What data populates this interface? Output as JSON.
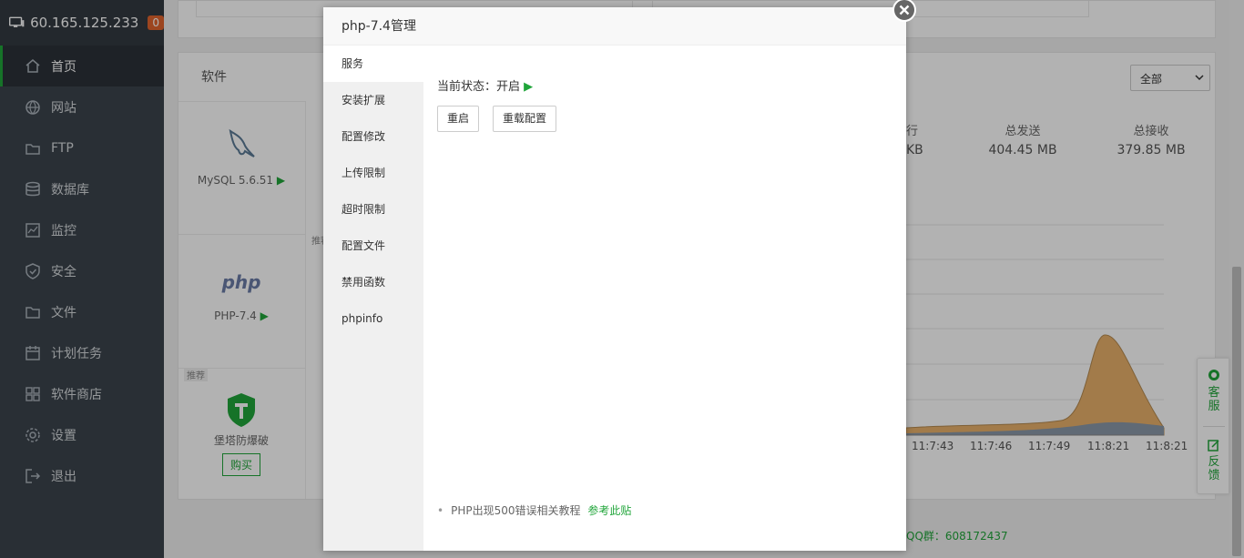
{
  "sidebar": {
    "server_ip": "60.165.125.233",
    "notification_count": "0",
    "items": [
      {
        "label": "首页",
        "icon": "home-icon",
        "active": true
      },
      {
        "label": "网站",
        "icon": "globe-icon"
      },
      {
        "label": "FTP",
        "icon": "ftp-icon"
      },
      {
        "label": "数据库",
        "icon": "database-icon"
      },
      {
        "label": "监控",
        "icon": "monitor-icon"
      },
      {
        "label": "安全",
        "icon": "shield-icon"
      },
      {
        "label": "文件",
        "icon": "folder-icon"
      },
      {
        "label": "计划任务",
        "icon": "calendar-icon"
      },
      {
        "label": "软件商店",
        "icon": "grid-icon"
      },
      {
        "label": "设置",
        "icon": "gear-icon"
      },
      {
        "label": "退出",
        "icon": "logout-icon"
      }
    ]
  },
  "software": {
    "title": "软件",
    "filter_value": "全部",
    "items": [
      {
        "name": "MySQL 5.6.51",
        "icon": "mysql-dolphin-icon"
      },
      {
        "name": "PHP-7.4",
        "icon": "php-logo-icon"
      },
      {
        "name": "堡塔防爆破",
        "icon": "shield-hammer-icon",
        "tag": "推荐",
        "button": "购买"
      }
    ],
    "recommend_tag_mid": "推荐"
  },
  "traffic": {
    "partial_label": "行",
    "partial_value": "KB",
    "total_sent_label": "总发送",
    "total_sent": "404.45 MB",
    "total_recv_label": "总接收",
    "total_recv": "379.85 MB",
    "x_ticks": [
      "11:7:43",
      "11:7:46",
      "11:7:49",
      "11:8:21",
      "11:8:21"
    ]
  },
  "footer": {
    "qq_group": "QQ群：608172437"
  },
  "float_panel": {
    "support_label": "客服",
    "feedback_label": "反馈",
    "support_icon": "headset-icon",
    "feedback_icon": "edit-icon"
  },
  "dialog": {
    "title": "php-7.4管理",
    "menu": [
      "服务",
      "安装扩展",
      "配置修改",
      "上传限制",
      "超时限制",
      "配置文件",
      "禁用函数",
      "phpinfo"
    ],
    "status_label": "当前状态：开启",
    "restart_button": "重启",
    "reload_button": "重载配置",
    "tip_text": "PHP出现500错误相关教程",
    "tip_link": "参考此贴",
    "close_icon": "close-circle-icon"
  },
  "colors": {
    "accent": "#20a53a",
    "sidebar": "#3c444d",
    "badge": "#e0642d"
  }
}
